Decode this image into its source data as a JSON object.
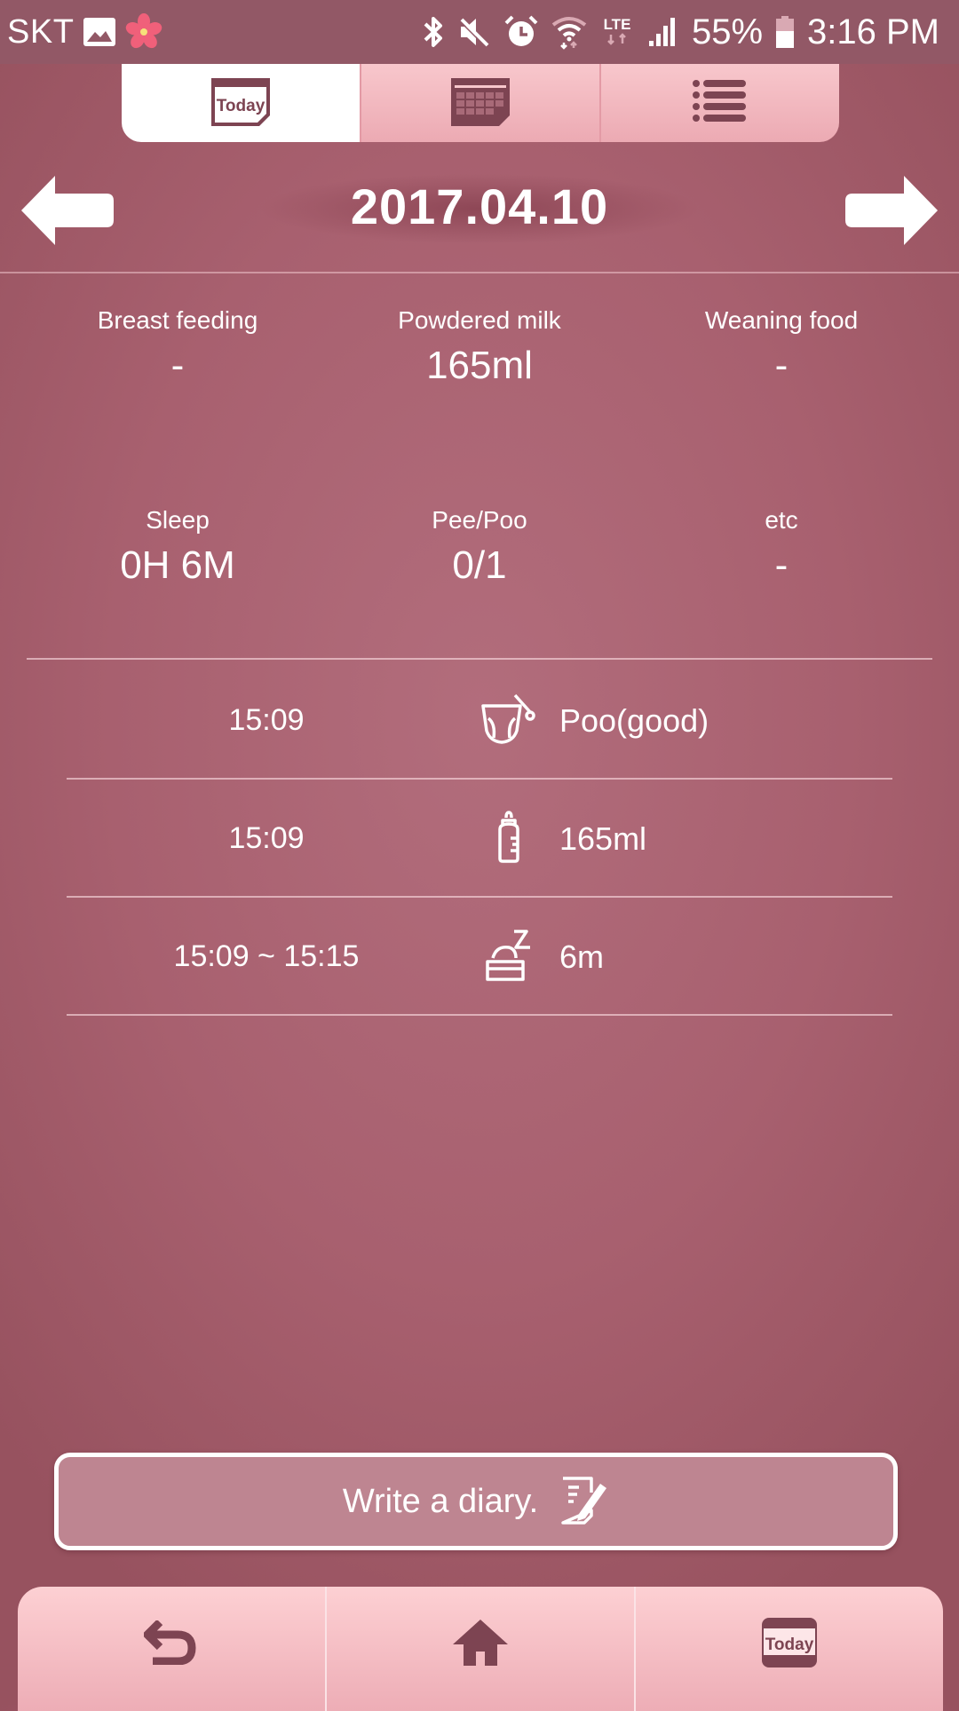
{
  "status_bar": {
    "carrier": "SKT",
    "left_icons": [
      "gallery-icon",
      "flower-icon"
    ],
    "right_icons": [
      "bluetooth-icon",
      "mute-icon",
      "alarm-icon",
      "wifi-icon",
      "lte-icon",
      "signal-icon"
    ],
    "lte_label": "LTE",
    "battery": "55%",
    "time": "3:16 PM"
  },
  "top_tabs": [
    {
      "name": "today",
      "icon": "today-calendar-icon",
      "icon_text": "Today",
      "active": true
    },
    {
      "name": "calendar",
      "icon": "calendar-grid-icon",
      "active": false
    },
    {
      "name": "list",
      "icon": "list-icon",
      "active": false
    }
  ],
  "date_nav": {
    "date": "2017.04.10",
    "prev_icon": "arrow-left-icon",
    "next_icon": "arrow-right-icon"
  },
  "summary": [
    {
      "label": "Breast feeding",
      "value": "-"
    },
    {
      "label": "Powdered milk",
      "value": "165ml"
    },
    {
      "label": "Weaning food",
      "value": "-"
    },
    {
      "label": "Sleep",
      "value": "0H 6M"
    },
    {
      "label": "Pee/Poo",
      "value": "0/1"
    },
    {
      "label": "etc",
      "value": "-"
    }
  ],
  "log": [
    {
      "time": "15:09",
      "icon": "diaper-icon",
      "text": "Poo(good)"
    },
    {
      "time": "15:09",
      "icon": "baby-bottle-icon",
      "text": "165ml"
    },
    {
      "time": "15:09 ~ 15:15",
      "icon": "sleeping-baby-icon",
      "text": "6m"
    }
  ],
  "diary_button": {
    "label": "Write a diary.",
    "icon": "edit-note-icon"
  },
  "bottom_nav": [
    {
      "name": "back",
      "icon": "back-icon"
    },
    {
      "name": "home",
      "icon": "home-icon"
    },
    {
      "name": "today",
      "icon": "today-calendar-icon",
      "icon_text": "Today"
    }
  ],
  "colors": {
    "background": "#a8606f",
    "status_bar": "#925866",
    "tab_pink": "#f3b8c0",
    "icon_maroon": "#7d4452",
    "diary_button": "#be8591"
  }
}
